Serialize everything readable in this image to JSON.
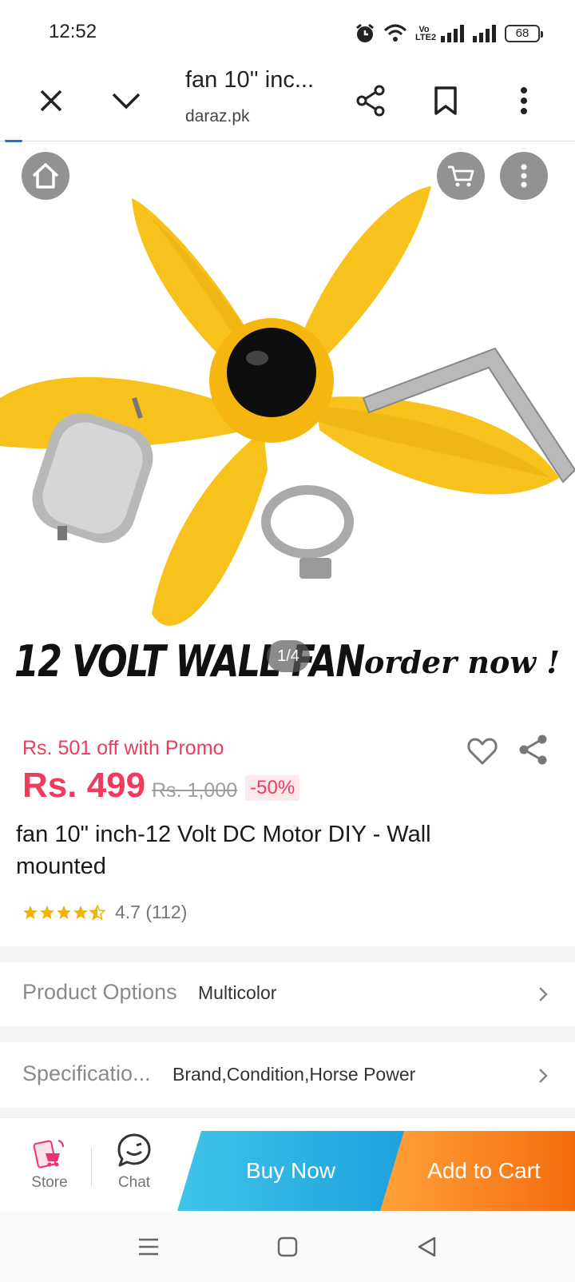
{
  "status": {
    "time": "12:52",
    "battery": "68",
    "volte": "Vo LTE2"
  },
  "browser": {
    "title": "fan 10'' inc...",
    "url": "daraz.pk"
  },
  "hero": {
    "banner_left": "12 VOLT WALL FAN",
    "banner_right": "order now !",
    "counter": "1/4"
  },
  "product": {
    "promo": "Rs. 501 off with Promo",
    "price": "Rs. 499",
    "old_price": "Rs. 1,000",
    "discount": "-50%",
    "title": "fan 10\" inch-12 Volt DC Motor DIY - Wall mounted",
    "rating": 4.7,
    "rating_text": "4.7 (112)"
  },
  "options": {
    "label": "Product Options",
    "value": "Multicolor"
  },
  "specs": {
    "label": "Specificatio...",
    "value": "Brand,Condition,Horse Power"
  },
  "actions": {
    "store": "Store",
    "chat": "Chat",
    "buy_now": "Buy Now",
    "add_to_cart": "Add to Cart"
  },
  "colors": {
    "accent": "#f23a5e",
    "buy": "#1ea1dd",
    "cart": "#f56c0f",
    "star": "#f5b301"
  },
  "icons": [
    "close-icon",
    "chevron-down-icon",
    "share-icon",
    "bookmark-icon",
    "more-vert-icon",
    "home-icon",
    "cart-icon",
    "heart-icon",
    "star-icon",
    "chevron-right-icon",
    "store-icon",
    "chat-icon",
    "menu-icon",
    "square-icon",
    "back-icon"
  ]
}
